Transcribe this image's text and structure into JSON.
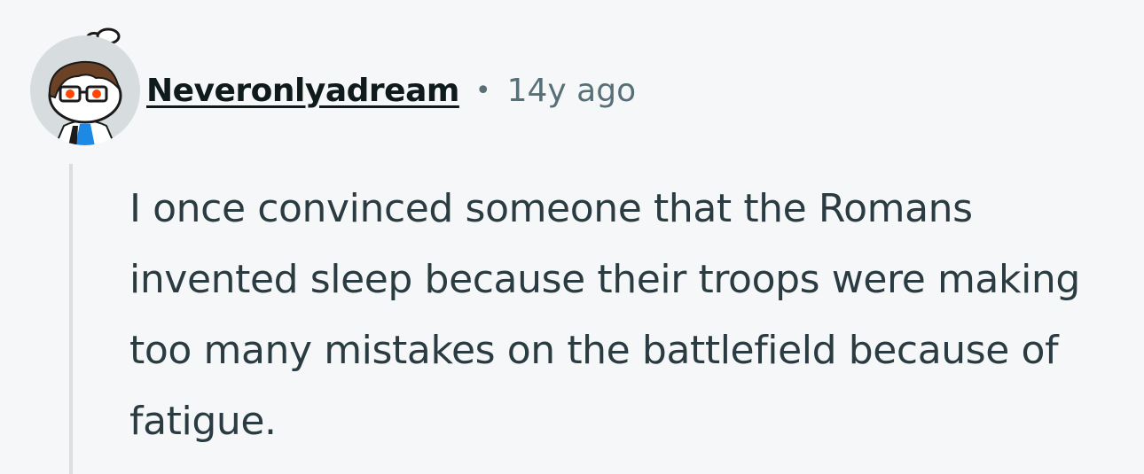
{
  "comment": {
    "author": "Neveronlyadream",
    "separator": "•",
    "timestamp": "14y ago",
    "body": "I once convinced someone that the Romans invented sleep because their troops were making too many mistakes on the battlefield because of fatigue.",
    "avatar_icon": "reddit-snoo-avatar-icon"
  },
  "colors": {
    "background": "#f6f7f8",
    "author_text": "#0f1a1c",
    "meta_text": "#576f76",
    "body_text": "#2a3c42",
    "thread_line": "#d9dee0",
    "avatar_bg": "#d7dcde",
    "avatar_eyes": "#ff4500",
    "avatar_hair": "#6b4226",
    "avatar_shirt": "#1e88e5"
  }
}
